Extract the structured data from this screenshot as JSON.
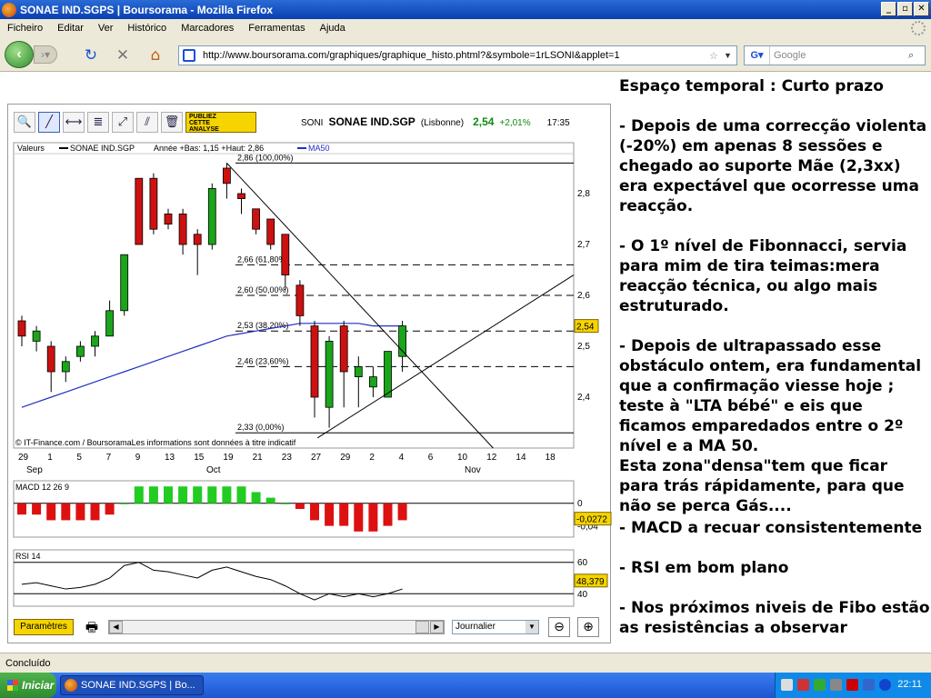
{
  "window": {
    "title": "SONAE IND.SGPS | Boursorama - Mozilla Firefox",
    "minimize": "_",
    "restore": "▫",
    "close": "✕"
  },
  "menu": [
    "Ficheiro",
    "Editar",
    "Ver",
    "Histórico",
    "Marcadores",
    "Ferramentas",
    "Ajuda"
  ],
  "nav": {
    "url": "http://www.boursorama.com/graphiques/graphique_histo.phtml?&symbole=1rLSONI&applet=1",
    "search_placeholder": "Google"
  },
  "chart_header": {
    "symbol": "SONI",
    "name": "SONAE IND.SGP",
    "market": "(Lisbonne)",
    "price": "2,54",
    "change": "+2,01%",
    "time": "17:35",
    "ad_line1": "PUBLIEZ",
    "ad_line2": "CETTE",
    "ad_line3": "ANALYSE"
  },
  "chart_data": {
    "type": "candlestick",
    "legend": [
      "Valeurs",
      "SONAE IND.SGP",
      "Année +Bas: 1,15 +Haut: 2,86",
      "MA50"
    ],
    "credit": "© IT-Finance.com / BoursoramaLes informations sont données à titre indicatif",
    "price_axis": {
      "min": 2.3,
      "max": 2.9,
      "ticks": [
        "2,8",
        "2,7",
        "2,6",
        "2,5",
        "2,4"
      ],
      "tick_values": [
        2.8,
        2.7,
        2.6,
        2.5,
        2.4
      ],
      "last_price_label": "2,54"
    },
    "x_ticks": [
      "29",
      "1",
      "5",
      "7",
      "9",
      "13",
      "15",
      "19",
      "21",
      "23",
      "27",
      "29",
      "2",
      "4",
      "6",
      "10",
      "12",
      "14",
      "18"
    ],
    "months": [
      "Sep",
      "Oct",
      "Nov"
    ],
    "fibonacci": [
      {
        "label": "2,86 (100,00%)",
        "value": 2.86
      },
      {
        "label": "2,66 (61,80%)",
        "value": 2.66
      },
      {
        "label": "2,60 (50,00%)",
        "value": 2.6
      },
      {
        "label": "2,53 (38,20%)",
        "value": 2.53
      },
      {
        "label": "2,46 (23,60%)",
        "value": 2.46
      },
      {
        "label": "2,33 (0,00%)",
        "value": 2.33
      }
    ],
    "candles": [
      {
        "o": 2.55,
        "c": 2.52,
        "h": 2.56,
        "l": 2.5
      },
      {
        "o": 2.51,
        "c": 2.53,
        "h": 2.54,
        "l": 2.49
      },
      {
        "o": 2.5,
        "c": 2.45,
        "h": 2.51,
        "l": 2.41
      },
      {
        "o": 2.45,
        "c": 2.47,
        "h": 2.48,
        "l": 2.43
      },
      {
        "o": 2.48,
        "c": 2.5,
        "h": 2.51,
        "l": 2.47
      },
      {
        "o": 2.5,
        "c": 2.52,
        "h": 2.53,
        "l": 2.48
      },
      {
        "o": 2.52,
        "c": 2.57,
        "h": 2.59,
        "l": 2.52
      },
      {
        "o": 2.57,
        "c": 2.68,
        "h": 2.68,
        "l": 2.56
      },
      {
        "o": 2.83,
        "c": 2.7,
        "h": 2.83,
        "l": 2.7
      },
      {
        "o": 2.83,
        "c": 2.73,
        "h": 2.84,
        "l": 2.72
      },
      {
        "o": 2.76,
        "c": 2.74,
        "h": 2.77,
        "l": 2.73
      },
      {
        "o": 2.76,
        "c": 2.7,
        "h": 2.77,
        "l": 2.68
      },
      {
        "o": 2.72,
        "c": 2.7,
        "h": 2.73,
        "l": 2.64
      },
      {
        "o": 2.7,
        "c": 2.81,
        "h": 2.82,
        "l": 2.69
      },
      {
        "o": 2.85,
        "c": 2.82,
        "h": 2.86,
        "l": 2.79
      },
      {
        "o": 2.8,
        "c": 2.79,
        "h": 2.81,
        "l": 2.76
      },
      {
        "o": 2.77,
        "c": 2.73,
        "h": 2.77,
        "l": 2.72
      },
      {
        "o": 2.75,
        "c": 2.7,
        "h": 2.75,
        "l": 2.69
      },
      {
        "o": 2.72,
        "c": 2.64,
        "h": 2.72,
        "l": 2.61
      },
      {
        "o": 2.62,
        "c": 2.56,
        "h": 2.63,
        "l": 2.54
      },
      {
        "o": 2.54,
        "c": 2.4,
        "h": 2.55,
        "l": 2.36
      },
      {
        "o": 2.38,
        "c": 2.51,
        "h": 2.52,
        "l": 2.34
      },
      {
        "o": 2.54,
        "c": 2.45,
        "h": 2.55,
        "l": 2.38
      },
      {
        "o": 2.44,
        "c": 2.46,
        "h": 2.48,
        "l": 2.38
      },
      {
        "o": 2.42,
        "c": 2.44,
        "h": 2.46,
        "l": 2.4
      },
      {
        "o": 2.4,
        "c": 2.49,
        "h": 2.49,
        "l": 2.4
      },
      {
        "o": 2.48,
        "c": 2.54,
        "h": 2.55,
        "l": 2.45
      }
    ],
    "ma50": [
      2.38,
      2.39,
      2.4,
      2.41,
      2.42,
      2.43,
      2.44,
      2.45,
      2.46,
      2.47,
      2.48,
      2.49,
      2.5,
      2.51,
      2.52,
      2.525,
      2.53,
      2.535,
      2.54,
      2.545,
      2.545,
      2.545,
      2.545,
      2.545,
      2.54,
      2.54,
      2.54
    ],
    "macd": {
      "label": "MACD 12 26 9",
      "axis": [
        "0",
        "-0,04"
      ],
      "value_label": "-0,0272",
      "values": [
        -0.02,
        -0.02,
        -0.03,
        -0.03,
        -0.03,
        -0.03,
        -0.02,
        0.0,
        0.03,
        0.03,
        0.03,
        0.03,
        0.03,
        0.03,
        0.03,
        0.03,
        0.02,
        0.01,
        0.0,
        -0.01,
        -0.03,
        -0.04,
        -0.04,
        -0.05,
        -0.05,
        -0.04,
        -0.03
      ]
    },
    "rsi": {
      "label": "RSI 14",
      "axis": [
        "60",
        "40"
      ],
      "value_label": "48,379",
      "values": [
        46,
        47,
        45,
        43,
        44,
        46,
        50,
        58,
        60,
        55,
        54,
        52,
        50,
        55,
        57,
        54,
        51,
        49,
        45,
        40,
        36,
        40,
        38,
        40,
        38,
        40,
        43
      ]
    }
  },
  "chart_controls": {
    "params": "Paramètres",
    "period": "Journalier"
  },
  "comment": [
    "Espaço temporal : Curto prazo",
    " - Depois de uma correcção violenta (-20%) em apenas 8 sessões e chegado ao suporte Mãe (2,3xx) era expectável que ocorresse uma reacção.",
    " - O 1º nível de Fibonnacci, servia para mim de tira teimas:mera reacção técnica, ou algo mais estruturado.",
    " - Depois de ultrapassado esse obstáculo ontem, era fundamental que a confirmação viesse hoje ; teste à \"LTA bébé\" e eis que ficamos emparedados entre o 2º nível e a MA 50.\nEsta zona\"densa\"tem que ficar para trás rápidamente, para que não se perca Gás....",
    "- MACD a recuar consistentemente",
    "- RSI em bom plano",
    "- Nos próximos niveis de Fibo estão as resistências a observar"
  ],
  "status": "Concluído",
  "taskbar": {
    "start": "Iniciar",
    "task": "SONAE IND.SGPS | Bo...",
    "clock": "22:11"
  }
}
